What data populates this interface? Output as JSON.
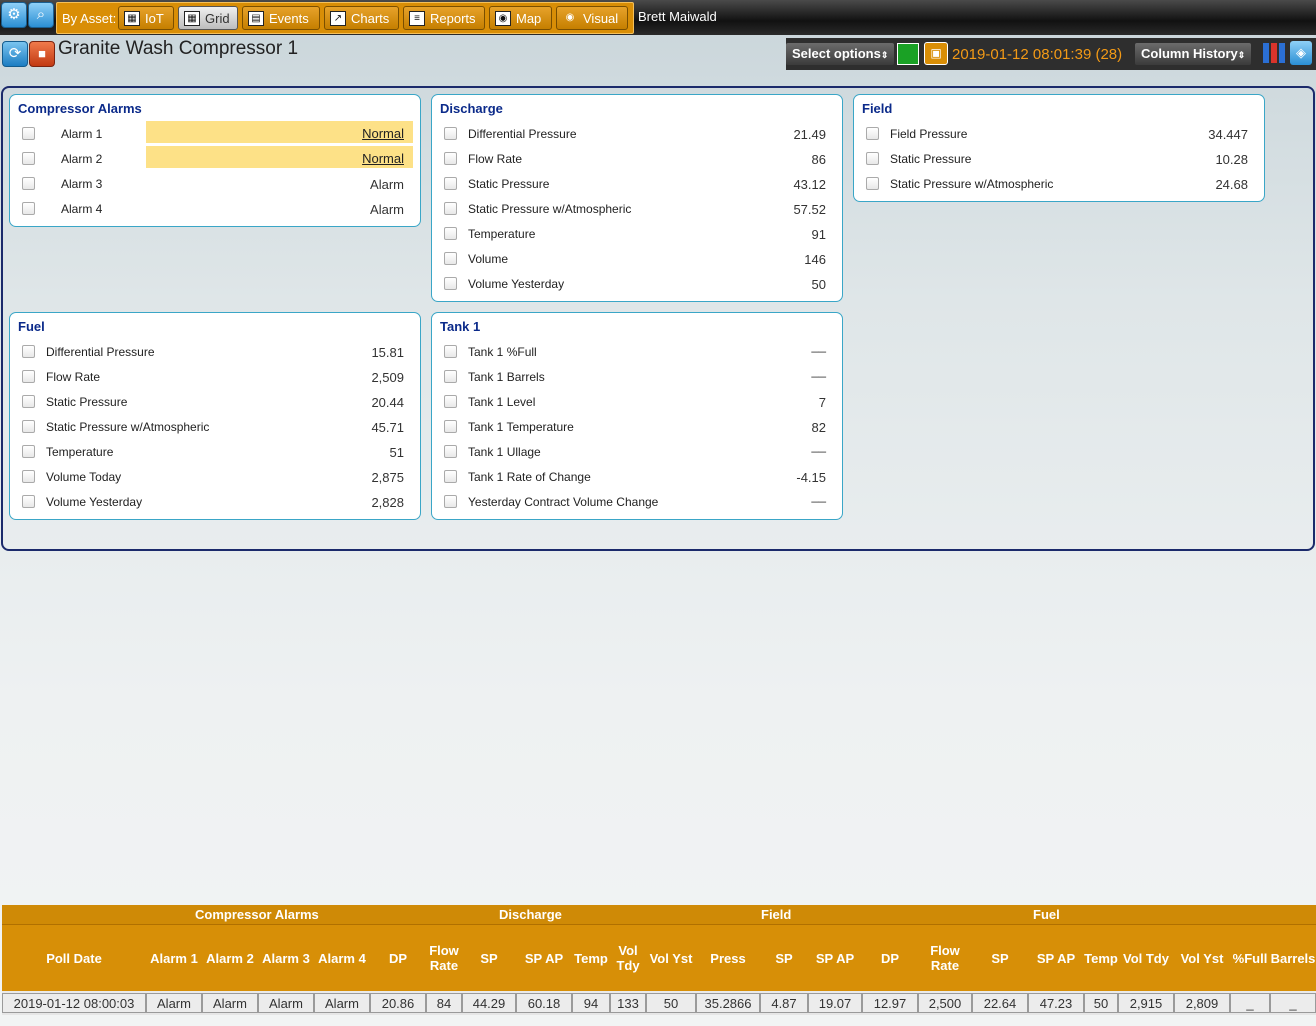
{
  "topbar": {
    "settings_icon": "gear-icon",
    "search_icon": "search-icon",
    "by_asset_label": "By Asset:",
    "nav": [
      {
        "label": "IoT",
        "icon": "iot-icon"
      },
      {
        "label": "Grid",
        "icon": "grid-icon"
      },
      {
        "label": "Events",
        "icon": "calendar-icon"
      },
      {
        "label": "Charts",
        "icon": "chart-icon"
      },
      {
        "label": "Reports",
        "icon": "clipboard-icon"
      },
      {
        "label": "Map",
        "icon": "map-icon"
      },
      {
        "label": "Visual",
        "icon": "eye-icon"
      }
    ],
    "user": "Brett Maiwald"
  },
  "header": {
    "asset_title": "Granite Wash Compressor 1",
    "select_options": "Select options",
    "poll_time": "2019-01-12 08:01:39 (28)",
    "column_history": "Column History",
    "status_color": "#1aa125"
  },
  "panels": {
    "compressor_alarms": {
      "title": "Compressor Alarms",
      "rows": [
        {
          "label": "Alarm 1",
          "value": "Normal"
        },
        {
          "label": "Alarm 2",
          "value": "Normal"
        },
        {
          "label": "Alarm 3",
          "value": "Alarm"
        },
        {
          "label": "Alarm 4",
          "value": "Alarm"
        }
      ]
    },
    "discharge": {
      "title": "Discharge",
      "rows": [
        {
          "label": "Differential Pressure",
          "value": "21.49"
        },
        {
          "label": "Flow Rate",
          "value": "86"
        },
        {
          "label": "Static Pressure",
          "value": "43.12"
        },
        {
          "label": "Static Pressure w/Atmospheric",
          "value": "57.52"
        },
        {
          "label": "Temperature",
          "value": "91"
        },
        {
          "label": "Volume",
          "value": "146"
        },
        {
          "label": "Volume Yesterday",
          "value": "50"
        }
      ]
    },
    "field": {
      "title": "Field",
      "rows": [
        {
          "label": "Field Pressure",
          "value": "34.447"
        },
        {
          "label": "Static Pressure",
          "value": "10.28"
        },
        {
          "label": "Static Pressure w/Atmospheric",
          "value": "24.68"
        }
      ]
    },
    "fuel": {
      "title": "Fuel",
      "rows": [
        {
          "label": "Differential Pressure",
          "value": "15.81"
        },
        {
          "label": "Flow Rate",
          "value": "2,509"
        },
        {
          "label": "Static Pressure",
          "value": "20.44"
        },
        {
          "label": "Static Pressure w/Atmospheric",
          "value": "45.71"
        },
        {
          "label": "Temperature",
          "value": "51"
        },
        {
          "label": "Volume Today",
          "value": "2,875"
        },
        {
          "label": "Volume Yesterday",
          "value": "2,828"
        }
      ]
    },
    "tank1": {
      "title": "Tank 1",
      "rows": [
        {
          "label": "Tank 1 %Full",
          "value": "__"
        },
        {
          "label": "Tank 1 Barrels",
          "value": "__"
        },
        {
          "label": "Tank 1 Level",
          "value": "7"
        },
        {
          "label": "Tank 1 Temperature",
          "value": "82"
        },
        {
          "label": "Tank 1 Ullage",
          "value": "__"
        },
        {
          "label": "Tank 1 Rate of Change",
          "value": "-4.15"
        },
        {
          "label": "Yesterday Contract Volume Change",
          "value": "__"
        }
      ]
    }
  },
  "grid": {
    "groups": [
      "Compressor Alarms",
      "Discharge",
      "Field",
      "Fuel"
    ],
    "columns": [
      "Poll Date",
      "Alarm 1",
      "Alarm 2",
      "Alarm 3",
      "Alarm 4",
      "DP",
      "Flow Rate",
      "SP",
      "SP AP",
      "Temp",
      "Vol Tdy",
      "Vol Yst",
      "Press",
      "SP",
      "SP AP",
      "DP",
      "Flow Rate",
      "SP",
      "SP AP",
      "Temp",
      "Vol Tdy",
      "Vol Yst",
      "%Full",
      "Barrels"
    ],
    "row": [
      "2019-01-12 08:00:03",
      "Alarm",
      "Alarm",
      "Alarm",
      "Alarm",
      "20.86",
      "84",
      "44.29",
      "60.18",
      "94",
      "133",
      "50",
      "35.2866",
      "4.87",
      "19.07",
      "12.97",
      "2,500",
      "22.64",
      "47.23",
      "50",
      "2,915",
      "2,809",
      "_",
      "_"
    ]
  }
}
